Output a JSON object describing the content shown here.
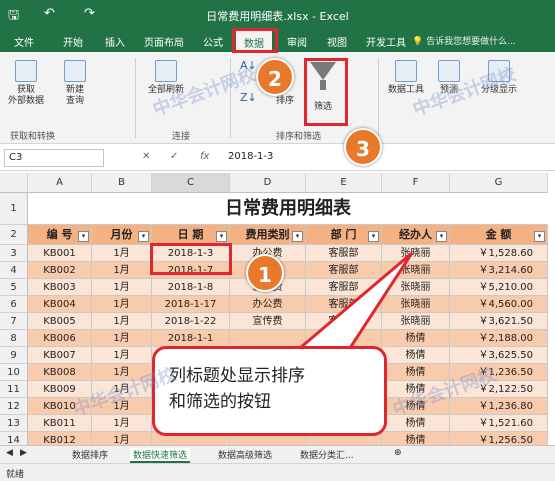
{
  "window": {
    "title": "日常费用明细表.xlsx - Excel"
  },
  "tabs": [
    "文件",
    "开始",
    "插入",
    "页面布局",
    "公式",
    "数据",
    "审阅",
    "视图",
    "开发工具"
  ],
  "tell_me": "告诉我您想要做什么...",
  "ribbon": {
    "get_data": "获取\n外部数据",
    "new_query": "新建\n查询",
    "get_transform": "获取和转换",
    "refresh": "全部刷新",
    "connections": "连接",
    "sort": "排序",
    "filter": "筛选",
    "sort_filter": "排序和筛选",
    "data_tools": "数据工具",
    "forecast": "预测",
    "outline": "分级显示"
  },
  "formula_bar": {
    "name_box": "C3",
    "fx": "fx",
    "value": "2018-1-3"
  },
  "columns": [
    "A",
    "B",
    "C",
    "D",
    "E",
    "F",
    "G"
  ],
  "sheet_title": "日常费用明细表",
  "headers": [
    "编 号",
    "月份",
    "日 期",
    "费用类别",
    "部 门",
    "经办人",
    "金 额"
  ],
  "rows": [
    [
      "KB001",
      "1月",
      "2018-1-3",
      "办公费",
      "客服部",
      "张晓丽",
      "￥1,528.60"
    ],
    [
      "KB002",
      "1月",
      "2018-1-7",
      "",
      "客服部",
      "张晓丽",
      "￥3,214.60"
    ],
    [
      "KB003",
      "1月",
      "2018-1-8",
      "差旅费",
      "客服部",
      "张晓丽",
      "￥5,210.00"
    ],
    [
      "KB004",
      "1月",
      "2018-1-17",
      "办公费",
      "客服部",
      "张晓丽",
      "￥4,560.00"
    ],
    [
      "KB005",
      "1月",
      "2018-1-22",
      "宣传费",
      "客服部",
      "张晓丽",
      "￥3,621.50"
    ],
    [
      "KB006",
      "1月",
      "2018-1-1",
      "",
      "",
      "杨倩",
      "￥2,188.00"
    ],
    [
      "KB007",
      "1月",
      "",
      "",
      "",
      "杨倩",
      "￥3,625.50"
    ],
    [
      "KB008",
      "1月",
      "",
      "",
      "",
      "杨倩",
      "￥1,236.50"
    ],
    [
      "KB009",
      "1月",
      "",
      "",
      "",
      "杨倩",
      "￥2,122.50"
    ],
    [
      "KB010",
      "1月",
      "",
      "",
      "",
      "杨倩",
      "￥1,236.80"
    ],
    [
      "KB011",
      "1月",
      "",
      "",
      "",
      "杨倩",
      "￥1,521.60"
    ],
    [
      "KB012",
      "1月",
      "",
      "",
      "",
      "杨倩",
      "￥1,256.50"
    ]
  ],
  "sheet_tabs": [
    "数据排序",
    "数据快速筛选",
    "数据高级筛选",
    "数据分类汇..."
  ],
  "status": "就绪",
  "callout": "列标题处显示排序\n和筛选的按钮",
  "badges": [
    "1",
    "2",
    "3"
  ],
  "watermark": "中华会计网校",
  "watermark_url": "www.chinaacc.com",
  "colors": {
    "title_bar": "#217346",
    "header_fill": "#f4b183",
    "row_light": "#fbe5d6",
    "row_dark": "#f8cbad",
    "highlight": "#e0262e",
    "badge": "#e8792a"
  }
}
